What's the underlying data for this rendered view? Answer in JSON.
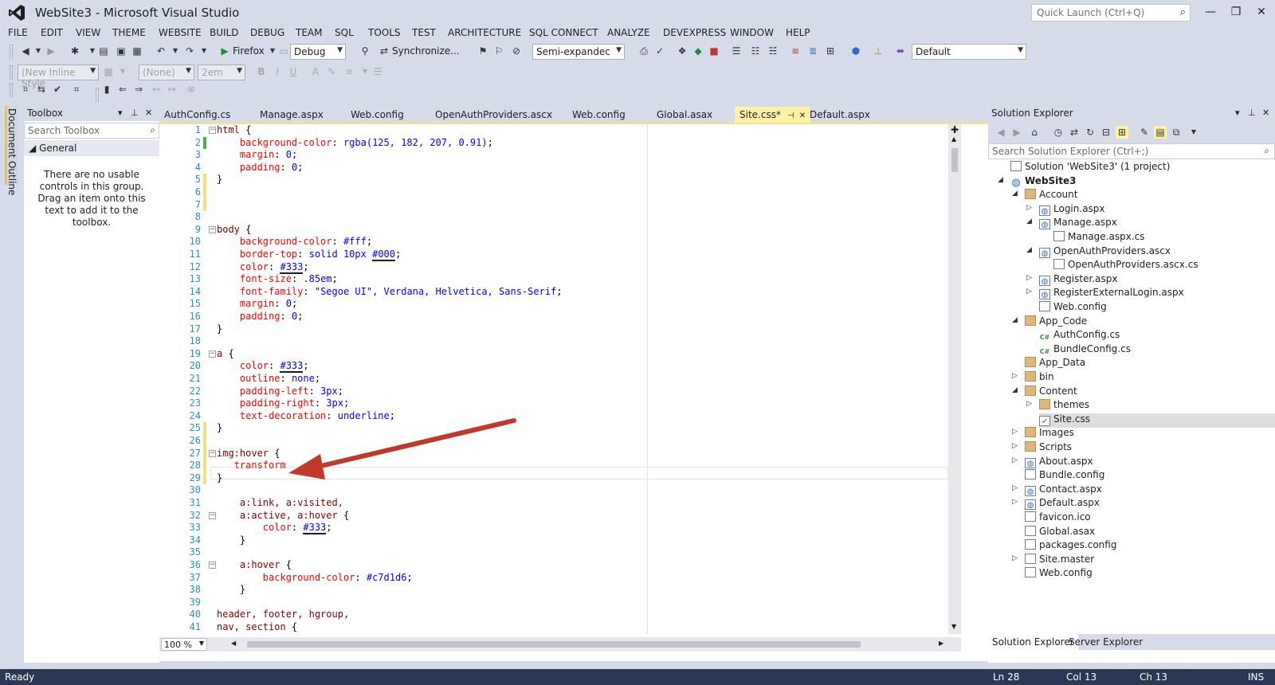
{
  "window": {
    "title": "WebSite3 - Microsoft Visual Studio",
    "quick_launch_placeholder": "Quick Launch (Ctrl+Q)"
  },
  "menu": [
    "FILE",
    "EDIT",
    "VIEW",
    "THEME",
    "WEBSITE",
    "BUILD",
    "DEBUG",
    "TEAM",
    "SQL",
    "TOOLS",
    "TEST",
    "ARCHITECTURE",
    "SQL CONNECT",
    "ANALYZE",
    "DEVEXPRESS",
    "WINDOW",
    "HELP"
  ],
  "toolbar": {
    "browser": "Firefox",
    "config": "Debug",
    "sync": "Synchronize...",
    "view_mode": "Semi-expandec",
    "layout": "Default",
    "inline_style": "(New Inline Style",
    "font_name": "(None)",
    "font_size": "2em"
  },
  "left_tab": "Document Outline",
  "toolbox": {
    "title": "Toolbox",
    "search_placeholder": "Search Toolbox",
    "group": "General",
    "empty_message": "There are no usable controls in this group. Drag an item onto this text to add it to the toolbox."
  },
  "doc_tabs": [
    "AuthConfig.cs",
    "Manage.aspx",
    "Web.config",
    "OpenAuthProviders.ascx",
    "Web.config",
    "Global.asax",
    "Site.css*",
    "Default.aspx"
  ],
  "editor": {
    "zoom": "100 %",
    "lines": [
      {
        "n": "1",
        "t": [
          [
            "sel",
            "html "
          ],
          [
            "",
            "{"
          ]
        ]
      },
      {
        "n": "2",
        "t": [
          [
            "",
            "    "
          ],
          [
            "prop",
            "background-color"
          ],
          [
            "",
            ": "
          ],
          [
            "val",
            "rgba(125, 182, 207, 0.91)"
          ],
          [
            "",
            ";"
          ]
        ]
      },
      {
        "n": "3",
        "t": [
          [
            "",
            "    "
          ],
          [
            "prop",
            "margin"
          ],
          [
            "",
            ": "
          ],
          [
            "val",
            "0"
          ],
          [
            "",
            ";"
          ]
        ]
      },
      {
        "n": "4",
        "t": [
          [
            "",
            "    "
          ],
          [
            "prop",
            "padding"
          ],
          [
            "",
            ": "
          ],
          [
            "val",
            "0"
          ],
          [
            "",
            ";"
          ]
        ]
      },
      {
        "n": "5",
        "t": [
          [
            "",
            "}"
          ]
        ]
      },
      {
        "n": "6",
        "t": []
      },
      {
        "n": "7",
        "t": []
      },
      {
        "n": "8",
        "t": []
      },
      {
        "n": "9",
        "t": [
          [
            "sel",
            "body "
          ],
          [
            "",
            "{"
          ]
        ]
      },
      {
        "n": "10",
        "t": [
          [
            "",
            "    "
          ],
          [
            "prop",
            "background-color"
          ],
          [
            "",
            ": "
          ],
          [
            "val",
            "#fff"
          ],
          [
            "",
            ";"
          ]
        ]
      },
      {
        "n": "11",
        "t": [
          [
            "",
            "    "
          ],
          [
            "prop",
            "border-top"
          ],
          [
            "",
            ": "
          ],
          [
            "val",
            "solid 10px "
          ],
          [
            "valu",
            "#000"
          ],
          [
            "",
            ";"
          ]
        ]
      },
      {
        "n": "12",
        "t": [
          [
            "",
            "    "
          ],
          [
            "prop",
            "color"
          ],
          [
            "",
            ": "
          ],
          [
            "valu",
            "#333"
          ],
          [
            "",
            ";"
          ]
        ]
      },
      {
        "n": "13",
        "t": [
          [
            "",
            "    "
          ],
          [
            "prop",
            "font-size"
          ],
          [
            "",
            ": "
          ],
          [
            "val",
            ".85em"
          ],
          [
            "",
            ";"
          ]
        ]
      },
      {
        "n": "14",
        "t": [
          [
            "",
            "    "
          ],
          [
            "prop",
            "font-family"
          ],
          [
            "",
            ": "
          ],
          [
            "val",
            "\"Segoe UI\", Verdana, Helvetica, Sans-Serif"
          ],
          [
            "",
            ";"
          ]
        ]
      },
      {
        "n": "15",
        "t": [
          [
            "",
            "    "
          ],
          [
            "prop",
            "margin"
          ],
          [
            "",
            ": "
          ],
          [
            "val",
            "0"
          ],
          [
            "",
            ";"
          ]
        ]
      },
      {
        "n": "16",
        "t": [
          [
            "",
            "    "
          ],
          [
            "prop",
            "padding"
          ],
          [
            "",
            ": "
          ],
          [
            "val",
            "0"
          ],
          [
            "",
            ";"
          ]
        ]
      },
      {
        "n": "17",
        "t": [
          [
            "",
            "}"
          ]
        ]
      },
      {
        "n": "18",
        "t": []
      },
      {
        "n": "19",
        "t": [
          [
            "sel",
            "a "
          ],
          [
            "",
            "{"
          ]
        ]
      },
      {
        "n": "20",
        "t": [
          [
            "",
            "    "
          ],
          [
            "prop",
            "color"
          ],
          [
            "",
            ": "
          ],
          [
            "valu",
            "#333"
          ],
          [
            "",
            ";"
          ]
        ]
      },
      {
        "n": "21",
        "t": [
          [
            "",
            "    "
          ],
          [
            "prop",
            "outline"
          ],
          [
            "",
            ": "
          ],
          [
            "val",
            "none"
          ],
          [
            "",
            ";"
          ]
        ]
      },
      {
        "n": "22",
        "t": [
          [
            "",
            "    "
          ],
          [
            "prop",
            "padding-left"
          ],
          [
            "",
            ": "
          ],
          [
            "val",
            "3px"
          ],
          [
            "",
            ";"
          ]
        ]
      },
      {
        "n": "23",
        "t": [
          [
            "",
            "    "
          ],
          [
            "prop",
            "padding-right"
          ],
          [
            "",
            ": "
          ],
          [
            "val",
            "3px"
          ],
          [
            "",
            ";"
          ]
        ]
      },
      {
        "n": "24",
        "t": [
          [
            "",
            "    "
          ],
          [
            "prop",
            "text-decoration"
          ],
          [
            "",
            ": "
          ],
          [
            "val",
            "underline"
          ],
          [
            "",
            ";"
          ]
        ]
      },
      {
        "n": "25",
        "t": [
          [
            "",
            "}"
          ]
        ]
      },
      {
        "n": "26",
        "t": []
      },
      {
        "n": "27",
        "t": [
          [
            "sel",
            "img:hover "
          ],
          [
            "",
            "{"
          ]
        ]
      },
      {
        "n": "28",
        "t": [
          [
            "",
            "   "
          ],
          [
            "prop",
            "transform"
          ]
        ]
      },
      {
        "n": "29",
        "t": [
          [
            "",
            "}"
          ]
        ]
      },
      {
        "n": "30",
        "t": []
      },
      {
        "n": "31",
        "t": [
          [
            "",
            "    "
          ],
          [
            "sel",
            "a:link, a:visited,"
          ]
        ]
      },
      {
        "n": "32",
        "t": [
          [
            "",
            "    "
          ],
          [
            "sel",
            "a:active, a:hover "
          ],
          [
            "",
            "{"
          ]
        ]
      },
      {
        "n": "33",
        "t": [
          [
            "",
            "        "
          ],
          [
            "prop",
            "color"
          ],
          [
            "",
            ": "
          ],
          [
            "valu",
            "#333"
          ],
          [
            "",
            ";"
          ]
        ]
      },
      {
        "n": "34",
        "t": [
          [
            "",
            "    }"
          ]
        ]
      },
      {
        "n": "35",
        "t": []
      },
      {
        "n": "36",
        "t": [
          [
            "",
            "    "
          ],
          [
            "sel",
            "a:hover "
          ],
          [
            "",
            "{"
          ]
        ]
      },
      {
        "n": "37",
        "t": [
          [
            "",
            "        "
          ],
          [
            "prop",
            "background-color"
          ],
          [
            "",
            ": "
          ],
          [
            "val",
            "#c7d1d6"
          ],
          [
            "",
            ";"
          ]
        ]
      },
      {
        "n": "38",
        "t": [
          [
            "",
            "    }"
          ]
        ]
      },
      {
        "n": "39",
        "t": []
      },
      {
        "n": "40",
        "t": [
          [
            "sel",
            "header, footer, hgroup,"
          ]
        ]
      },
      {
        "n": "41",
        "t": [
          [
            "sel",
            "nav, section "
          ],
          [
            "",
            "{"
          ]
        ]
      }
    ]
  },
  "solution_explorer": {
    "title": "Solution Explorer",
    "search_placeholder": "Search Solution Explorer (Ctrl+;)",
    "tree": [
      {
        "label": "Solution 'WebSite3' (1 project)",
        "depth": 0,
        "tw": "",
        "icon": "file"
      },
      {
        "label": "WebSite3",
        "depth": 0,
        "tw": "◢",
        "icon": "globe",
        "bold": true
      },
      {
        "label": "Account",
        "depth": 1,
        "tw": "◢",
        "icon": "folder"
      },
      {
        "label": "Login.aspx",
        "depth": 2,
        "tw": "▷",
        "icon": "web"
      },
      {
        "label": "Manage.aspx",
        "depth": 2,
        "tw": "◢",
        "icon": "web"
      },
      {
        "label": "Manage.aspx.cs",
        "depth": 3,
        "tw": "",
        "icon": "file"
      },
      {
        "label": "OpenAuthProviders.ascx",
        "depth": 2,
        "tw": "◢",
        "icon": "web"
      },
      {
        "label": "OpenAuthProviders.ascx.cs",
        "depth": 3,
        "tw": "",
        "icon": "file"
      },
      {
        "label": "Register.aspx",
        "depth": 2,
        "tw": "▷",
        "icon": "web"
      },
      {
        "label": "RegisterExternalLogin.aspx",
        "depth": 2,
        "tw": "▷",
        "icon": "web"
      },
      {
        "label": "Web.config",
        "depth": 2,
        "tw": "",
        "icon": "file"
      },
      {
        "label": "App_Code",
        "depth": 1,
        "tw": "◢",
        "icon": "folder"
      },
      {
        "label": "AuthConfig.cs",
        "depth": 2,
        "tw": "",
        "icon": "cs"
      },
      {
        "label": "BundleConfig.cs",
        "depth": 2,
        "tw": "",
        "icon": "cs"
      },
      {
        "label": "App_Data",
        "depth": 1,
        "tw": "",
        "icon": "folder"
      },
      {
        "label": "bin",
        "depth": 1,
        "tw": "▷",
        "icon": "folder"
      },
      {
        "label": "Content",
        "depth": 1,
        "tw": "◢",
        "icon": "folder"
      },
      {
        "label": "themes",
        "depth": 2,
        "tw": "▷",
        "icon": "folder"
      },
      {
        "label": "Site.css",
        "depth": 2,
        "tw": "",
        "icon": "css",
        "selected": true
      },
      {
        "label": "Images",
        "depth": 1,
        "tw": "▷",
        "icon": "folder"
      },
      {
        "label": "Scripts",
        "depth": 1,
        "tw": "▷",
        "icon": "folder"
      },
      {
        "label": "About.aspx",
        "depth": 1,
        "tw": "▷",
        "icon": "web"
      },
      {
        "label": "Bundle.config",
        "depth": 1,
        "tw": "",
        "icon": "file"
      },
      {
        "label": "Contact.aspx",
        "depth": 1,
        "tw": "▷",
        "icon": "web"
      },
      {
        "label": "Default.aspx",
        "depth": 1,
        "tw": "▷",
        "icon": "web"
      },
      {
        "label": "favicon.ico",
        "depth": 1,
        "tw": "",
        "icon": "file"
      },
      {
        "label": "Global.asax",
        "depth": 1,
        "tw": "",
        "icon": "file"
      },
      {
        "label": "packages.config",
        "depth": 1,
        "tw": "",
        "icon": "file"
      },
      {
        "label": "Site.master",
        "depth": 1,
        "tw": "▷",
        "icon": "file"
      },
      {
        "label": "Web.config",
        "depth": 1,
        "tw": "",
        "icon": "file"
      }
    ],
    "bottom_tabs": [
      "Solution Explorer",
      "Server Explorer"
    ]
  },
  "status": {
    "text": "Ready",
    "ln": "Ln 28",
    "col": "Col 13",
    "ch": "Ch 13",
    "mode": "INS"
  },
  "colors": {
    "status_bar": "#293955",
    "active_tab": "#fff2a6",
    "annotation_arrow": "#c0392b"
  }
}
